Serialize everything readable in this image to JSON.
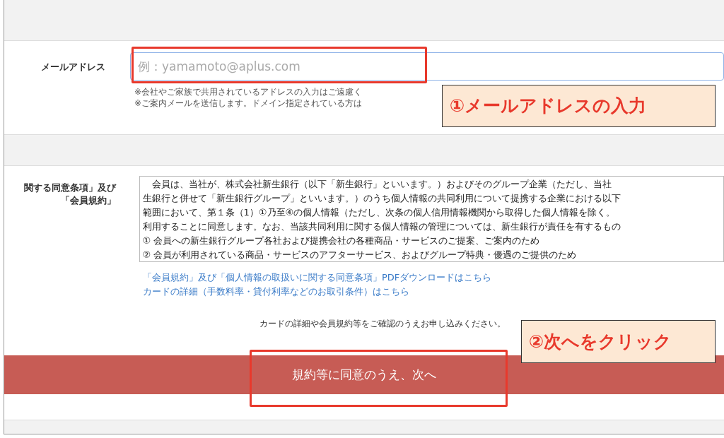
{
  "email": {
    "label": "メールアドレス",
    "placeholder": "例：yamamoto@aplus.com",
    "notes": [
      "※会社やご家族で共用されているアドレスの入力はご遠慮く",
      "※ご案内メールを送信します。ドメイン指定されている方は"
    ]
  },
  "terms": {
    "label_lines": [
      "関する同意条項」及び",
      "「会員規約」"
    ],
    "text_lines": [
      "　会員は、当社が、株式会社新生銀行（以下「新生銀行」といいます。）およびそのグループ企業（ただし、当社",
      "生銀行と併せて「新生銀行グループ」といいます。）のうち個人情報の共同利用について提携する企業における以下",
      "範囲において、第１条（1）①乃至④の個人情報（ただし、次条の個人信用情報機関から取得した個人情報を除く。",
      "利用することに同意します。なお、当該共同利用に関する個人情報の管理については、新生銀行が責任を有するもの",
      "① 会員への新生銀行グループ各社および提携会社の各種商品・サービスのご提案、ご案内のため",
      "② 会員が利用されている商品・サービスのアフターサービス、およびグループ特典・優遇のご提供のため"
    ]
  },
  "links": [
    "「会員規約」及び「個人情報の取扱いに関する同意条項」PDFダウンロードはこちら",
    "カードの詳細（手数料率・貸付利率などのお取引条件）はこちら"
  ],
  "confirm_note": "カードの詳細や会員規約等をご確認のうえお申し込みください。",
  "next_button": "規約等に同意のうえ、次へ",
  "callouts": [
    "①メールアドレスの入力",
    "②次へをクリック"
  ]
}
